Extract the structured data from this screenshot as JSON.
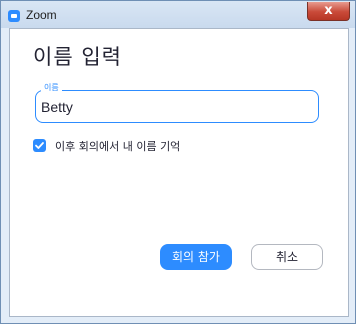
{
  "window": {
    "title": "Zoom",
    "close_glyph": "x",
    "app_icon": "zoom-app-icon",
    "close_icon": "close-icon"
  },
  "dialog": {
    "heading": "이름 입력",
    "name_field": {
      "label": "이름",
      "value": "Betty"
    },
    "remember_checkbox": {
      "label": "이후 회의에서 내 이름 기억",
      "checked": true
    },
    "join_label": "회의 참가",
    "cancel_label": "취소"
  },
  "colors": {
    "accent": "#2d8cff",
    "close_red": "#c94a39",
    "text": "#232333"
  }
}
